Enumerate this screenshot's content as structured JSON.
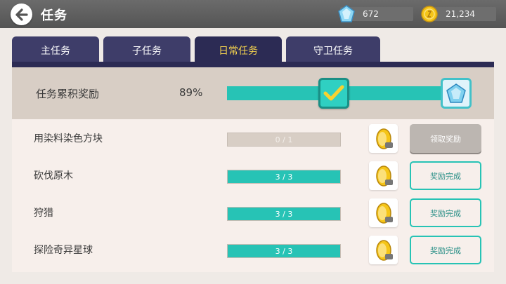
{
  "header": {
    "title": "任务",
    "gems": "672",
    "coins": "21,234"
  },
  "tabs": [
    {
      "label": "主任务",
      "active": false
    },
    {
      "label": "子任务",
      "active": false
    },
    {
      "label": "日常任务",
      "active": true
    },
    {
      "label": "守卫任务",
      "active": false
    }
  ],
  "summary": {
    "label": "任务累积奖励",
    "percent_text": "89%",
    "progress": 0.89
  },
  "tasks": [
    {
      "name": "用染料染色方块",
      "progress_text": "0 / 1",
      "progress": 0.0,
      "button": "领取奖励",
      "done": false
    },
    {
      "name": "砍伐原木",
      "progress_text": "3 / 3",
      "progress": 1.0,
      "button": "奖励完成",
      "done": true
    },
    {
      "name": "狩猎",
      "progress_text": "3 / 3",
      "progress": 1.0,
      "button": "奖励完成",
      "done": true
    },
    {
      "name": "探险奇异星球",
      "progress_text": "3 / 3",
      "progress": 1.0,
      "button": "奖励完成",
      "done": true
    }
  ],
  "colors": {
    "accent": "#27c3b5",
    "tab_active_text": "#f5d34e",
    "tab_bg": "#3e3d69"
  },
  "icons": {
    "back": "back-arrow-icon",
    "gem": "gem-icon",
    "coin": "coin-icon",
    "check": "check-icon",
    "reward": "coin-stack-icon"
  }
}
